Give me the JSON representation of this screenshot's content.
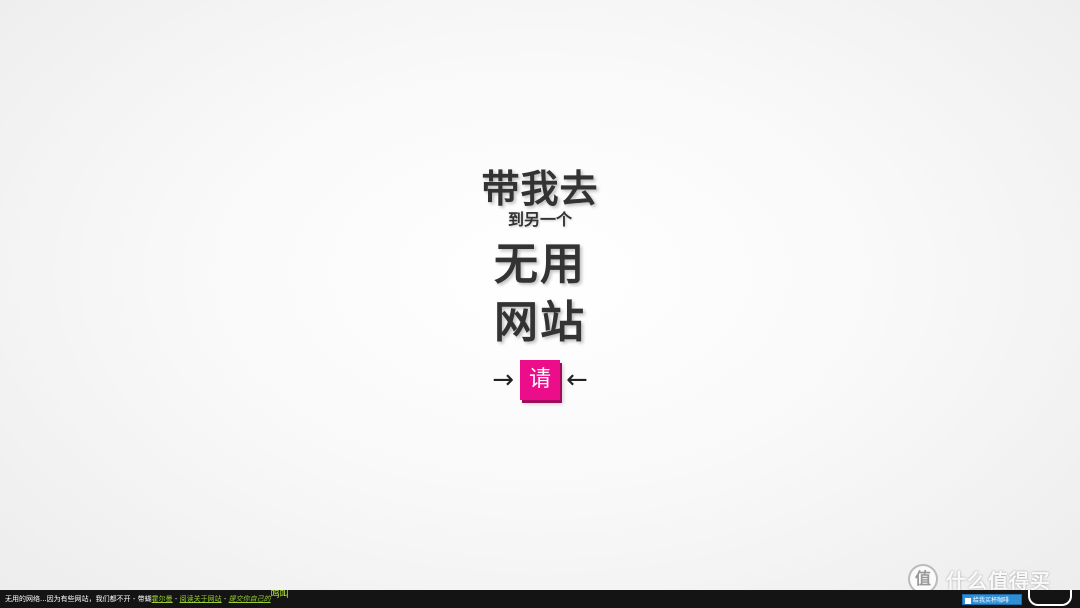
{
  "main": {
    "line1": "带我去",
    "line2": "到另一个",
    "line3": "无用",
    "line4": "网站",
    "arrow_left": "→",
    "arrow_right": "←",
    "please_button": "请"
  },
  "footer": {
    "intro": "无用的网络...因为有些网站，我们都不开 - 带蝴",
    "author_link": "霍尔曼",
    "sep1": " - ",
    "about_link": "阅读关于网站",
    "sep2": " - ",
    "submit_link": "提交你自己的",
    "shout": "呜叫",
    "pay_button": "给我买杯咖啡"
  },
  "watermark": {
    "icon_glyph": "值",
    "text": "什么值得买"
  },
  "colors": {
    "accent": "#ec0d8b",
    "footer_bg": "#141414",
    "link": "#9acd32",
    "pay_button": "#2d8fd6"
  }
}
